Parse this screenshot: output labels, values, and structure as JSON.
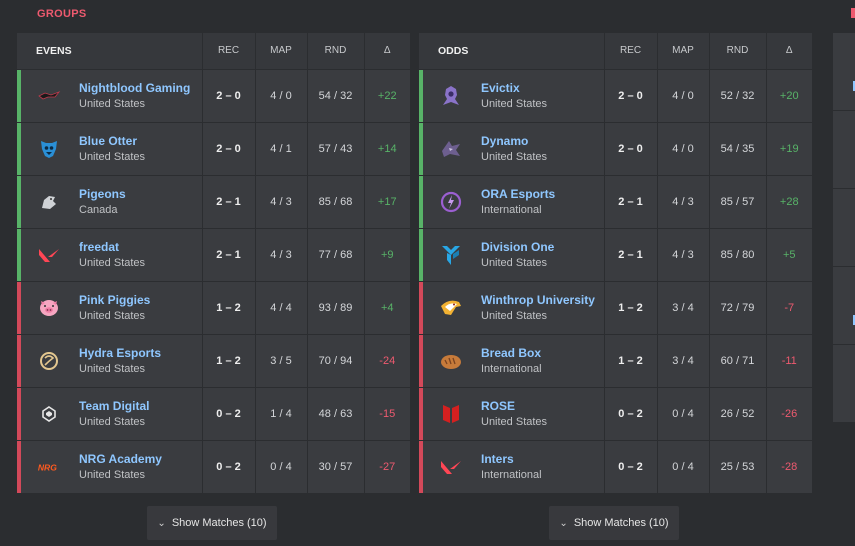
{
  "section_title": "GROUPS",
  "headers": {
    "rec": "REC",
    "map": "MAP",
    "rnd": "RND",
    "delta": "Δ"
  },
  "show_matches_label": "Show Matches (10)",
  "colors": {
    "win": "#58b368",
    "loss": "#d3495a",
    "link": "#8fc7ff",
    "accent": "#ee5a6f"
  },
  "groups": [
    {
      "name": "EVENS",
      "teams": [
        {
          "name": "Nightblood Gaming",
          "region": "United States",
          "rec": "2 – 0",
          "map": "4 / 0",
          "rnd": "54 / 32",
          "delta": "+22",
          "status": "win",
          "icon": "nightblood-logo-icon"
        },
        {
          "name": "Blue Otter",
          "region": "United States",
          "rec": "2 – 0",
          "map": "4 / 1",
          "rnd": "57 / 43",
          "delta": "+14",
          "status": "win",
          "icon": "blue-otter-logo-icon"
        },
        {
          "name": "Pigeons",
          "region": "Canada",
          "rec": "2 – 1",
          "map": "4 / 3",
          "rnd": "85 / 68",
          "delta": "+17",
          "status": "win",
          "icon": "pigeons-logo-icon"
        },
        {
          "name": "freedat",
          "region": "United States",
          "rec": "2 – 1",
          "map": "4 / 3",
          "rnd": "77 / 68",
          "delta": "+9",
          "status": "win",
          "icon": "valorant-logo-icon"
        },
        {
          "name": "Pink Piggies",
          "region": "United States",
          "rec": "1 – 2",
          "map": "4 / 4",
          "rnd": "93 / 89",
          "delta": "+4",
          "status": "loss",
          "icon": "pink-piggies-logo-icon"
        },
        {
          "name": "Hydra Esports",
          "region": "United States",
          "rec": "1 – 2",
          "map": "3 / 5",
          "rnd": "70 / 94",
          "delta": "-24",
          "status": "loss",
          "icon": "hydra-logo-icon"
        },
        {
          "name": "Team Digital",
          "region": "United States",
          "rec": "0 – 2",
          "map": "1 / 4",
          "rnd": "48 / 63",
          "delta": "-15",
          "status": "loss",
          "icon": "team-digital-logo-icon"
        },
        {
          "name": "NRG Academy",
          "region": "United States",
          "rec": "0 – 2",
          "map": "0 / 4",
          "rnd": "30 / 57",
          "delta": "-27",
          "status": "loss",
          "icon": "nrg-logo-icon"
        }
      ]
    },
    {
      "name": "ODDS",
      "teams": [
        {
          "name": "Evictix",
          "region": "United States",
          "rec": "2 – 0",
          "map": "4 / 0",
          "rnd": "52 / 32",
          "delta": "+20",
          "status": "win",
          "icon": "evictix-logo-icon"
        },
        {
          "name": "Dynamo",
          "region": "United States",
          "rec": "2 – 0",
          "map": "4 / 0",
          "rnd": "54 / 35",
          "delta": "+19",
          "status": "win",
          "icon": "dynamo-logo-icon"
        },
        {
          "name": "ORA Esports",
          "region": "International",
          "rec": "2 – 1",
          "map": "4 / 3",
          "rnd": "85 / 57",
          "delta": "+28",
          "status": "win",
          "icon": "ora-logo-icon"
        },
        {
          "name": "Division One",
          "region": "United States",
          "rec": "2 – 1",
          "map": "4 / 3",
          "rnd": "85 / 80",
          "delta": "+5",
          "status": "win",
          "icon": "division-one-logo-icon"
        },
        {
          "name": "Winthrop University",
          "region": "United States",
          "rec": "1 – 2",
          "map": "3 / 4",
          "rnd": "72 / 79",
          "delta": "-7",
          "status": "loss",
          "icon": "winthrop-logo-icon"
        },
        {
          "name": "Bread Box",
          "region": "International",
          "rec": "1 – 2",
          "map": "3 / 4",
          "rnd": "60 / 71",
          "delta": "-11",
          "status": "loss",
          "icon": "bread-box-logo-icon"
        },
        {
          "name": "ROSE",
          "region": "United States",
          "rec": "0 – 2",
          "map": "0 / 4",
          "rnd": "26 / 52",
          "delta": "-26",
          "status": "loss",
          "icon": "rose-logo-icon"
        },
        {
          "name": "Inters",
          "region": "International",
          "rec": "0 – 2",
          "map": "0 / 4",
          "rnd": "25 / 53",
          "delta": "-28",
          "status": "loss",
          "icon": "valorant-logo-icon"
        }
      ]
    }
  ]
}
